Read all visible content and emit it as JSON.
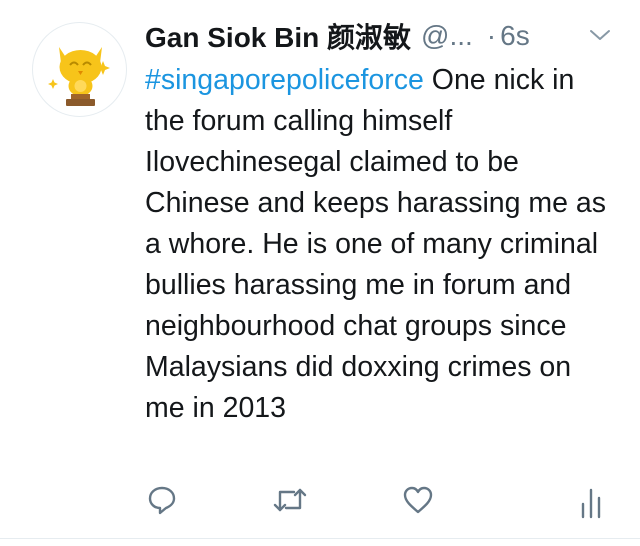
{
  "tweet": {
    "author_name": "Gan Siok Bin 颜淑敏",
    "handle": "@...",
    "separator": "·",
    "time": "6s",
    "hashtag": "#singaporepoliceforce",
    "text": " One nick in the forum calling himself Ilovechinesegal claimed to be Chinese and keeps harassing me as a whore. He is one of many criminal bullies harassing me in forum and neighbourhood chat groups since Malaysians did doxxing crimes on me in 2013"
  },
  "icons": {
    "avatar": "owl-trophy-avatar",
    "caret": "chevron-down-icon",
    "reply": "reply-icon",
    "retweet": "retweet-icon",
    "like": "heart-icon",
    "analytics": "analytics-icon"
  },
  "colors": {
    "link": "#1b95e0",
    "muted": "#657786",
    "text": "#14171a",
    "avatar_yellow": "#f7c41a"
  }
}
